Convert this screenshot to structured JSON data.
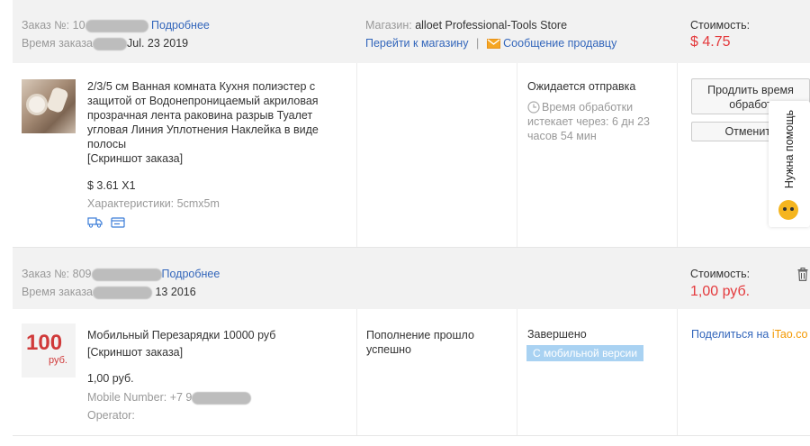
{
  "orders": [
    {
      "order_label": "Заказ №:",
      "order_prefix": "10",
      "details_link": "Подробнее",
      "time_label": "Время заказа",
      "time_suffix": "Jul. 23 2019",
      "store_label": "Магазин:",
      "store_name": "alloet Professional-Tools Store",
      "go_store": "Перейти к магазину",
      "separator": "|",
      "message_seller": "Сообщение продавцу",
      "cost_label": "Стоимость:",
      "cost_value": "$ 4.75",
      "item_title": "2/3/5 см Ванная комната Кухня полиэстер с защитой от Водонепроницаемый акриловая прозрачная лента раковина разрыв Туалет угловая Линия Уплотнения Наклейка в виде полосы",
      "snapshot": "[Скриншот заказа]",
      "item_price": "$ 3.61 X1",
      "properties": "Характеристики: 5cmx5m",
      "status": "Ожидается отправка",
      "processing_line1": "Время обработки",
      "processing_line2": "истекает через: 6 дн 23",
      "processing_line3": "часов 54 мин",
      "btn_extend_line1": "Продлить время",
      "btn_extend_line2": "обработ",
      "btn_cancel": "Отменить"
    },
    {
      "order_label": "Заказ №:",
      "order_prefix": "809",
      "details_link": "Подробнее",
      "time_label": "Время заказа",
      "time_suffix": "13 2016",
      "cost_label": "Стоимость:",
      "cost_value": "1,00 руб.",
      "item_title": "Мобильный Перезарядки 10000 руб",
      "snapshot": "[Скриншот заказа]",
      "thumb_big": "100",
      "thumb_small": "руб.",
      "item_price": "1,00 руб.",
      "mobile_number_label": "Mobile Number: +7 9",
      "operator_label": "Operator:",
      "refill_line1": "Пополнение прошло",
      "refill_line2": "успешно",
      "status": "Завершено",
      "mobile_badge": "С мобильной версии",
      "share_text": "Поделиться на ",
      "share_brand": "iTao.co"
    }
  ],
  "help_widget": {
    "label": "Нужна помощь"
  },
  "colors": {
    "price_red": "#e4393c",
    "link_blue": "#3366bb",
    "badge_blue": "#a9d2f2",
    "header_grey": "#f2f2f2"
  }
}
